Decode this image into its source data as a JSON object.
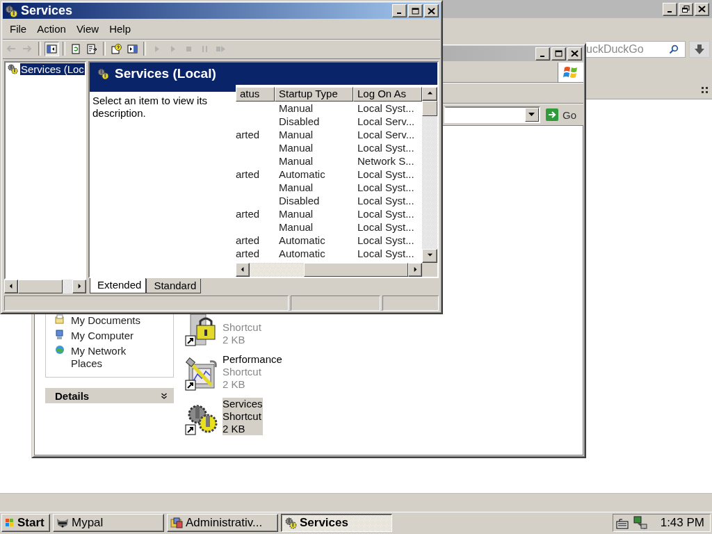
{
  "browser_window": {
    "search": {
      "placeholder": "uckDuckGo"
    }
  },
  "explorer_window": {
    "go_button": "Go",
    "tasks": [
      {
        "label": "My Documents",
        "kind": "documents"
      },
      {
        "label": "My Computer",
        "kind": "computer"
      },
      {
        "label": "My Network Places",
        "kind": "network"
      }
    ],
    "details_header": "Details",
    "files": [
      {
        "type": "Shortcut",
        "size": "2 KB",
        "kind": "lock",
        "selected": false
      },
      {
        "name": "Performance",
        "type": "Shortcut",
        "size": "2 KB",
        "kind": "performance",
        "selected": false
      },
      {
        "name": "Services",
        "type": "Shortcut",
        "size": "2 KB",
        "kind": "gears",
        "selected": true
      }
    ]
  },
  "services_window": {
    "title": "Services",
    "menu": [
      "File",
      "Action",
      "View",
      "Help"
    ],
    "toolbar": [
      {
        "kind": "back",
        "disabled": true,
        "pressed": false
      },
      {
        "kind": "forward",
        "disabled": true,
        "pressed": false
      },
      {
        "kind": "separator"
      },
      {
        "kind": "tree",
        "disabled": false,
        "pressed": true
      },
      {
        "kind": "separator"
      },
      {
        "kind": "refresh",
        "disabled": false,
        "pressed": false
      },
      {
        "kind": "export",
        "disabled": false,
        "pressed": false
      },
      {
        "kind": "separator"
      },
      {
        "kind": "help",
        "disabled": false,
        "pressed": false
      },
      {
        "kind": "pane",
        "disabled": false,
        "pressed": false
      },
      {
        "kind": "separator"
      },
      {
        "kind": "play",
        "disabled": true,
        "pressed": false
      },
      {
        "kind": "play",
        "disabled": true,
        "pressed": false
      },
      {
        "kind": "stop",
        "disabled": true,
        "pressed": false
      },
      {
        "kind": "pause",
        "disabled": true,
        "pressed": false
      },
      {
        "kind": "restart",
        "disabled": true,
        "pressed": false
      }
    ],
    "tree": [
      {
        "label": "Services (Loc",
        "selected": true
      }
    ],
    "header": "Services (Local)",
    "description": "Select an item to view its description.",
    "columns": [
      "atus",
      "Startup Type",
      "Log On As"
    ],
    "rows": [
      {
        "startup": "Manual",
        "logon": "Local Syst..."
      },
      {
        "startup": "Disabled",
        "logon": "Local Serv..."
      },
      {
        "status": "arted",
        "startup": "Manual",
        "logon": "Local Serv..."
      },
      {
        "startup": "Manual",
        "logon": "Local Syst..."
      },
      {
        "startup": "Manual",
        "logon": "Network S..."
      },
      {
        "status": "arted",
        "startup": "Automatic",
        "logon": "Local Syst..."
      },
      {
        "startup": "Manual",
        "logon": "Local Syst..."
      },
      {
        "startup": "Disabled",
        "logon": "Local Syst..."
      },
      {
        "status": "arted",
        "startup": "Manual",
        "logon": "Local Syst..."
      },
      {
        "startup": "Manual",
        "logon": "Local Syst..."
      },
      {
        "status": "arted",
        "startup": "Automatic",
        "logon": "Local Syst..."
      },
      {
        "status": "arted",
        "startup": "Automatic",
        "logon": "Local Syst..."
      }
    ],
    "tabs": [
      {
        "label": "Extended",
        "selected": true
      },
      {
        "label": "Standard",
        "selected": false
      }
    ]
  },
  "taskbar": {
    "start": "Start",
    "buttons": [
      {
        "label": "Mypal",
        "kind": "raccoon",
        "selected": false
      },
      {
        "label": "Administrativ...",
        "kind": "folder",
        "selected": false
      },
      {
        "label": "Services",
        "kind": "gears",
        "selected": true
      }
    ],
    "clock": "1:43 PM"
  }
}
